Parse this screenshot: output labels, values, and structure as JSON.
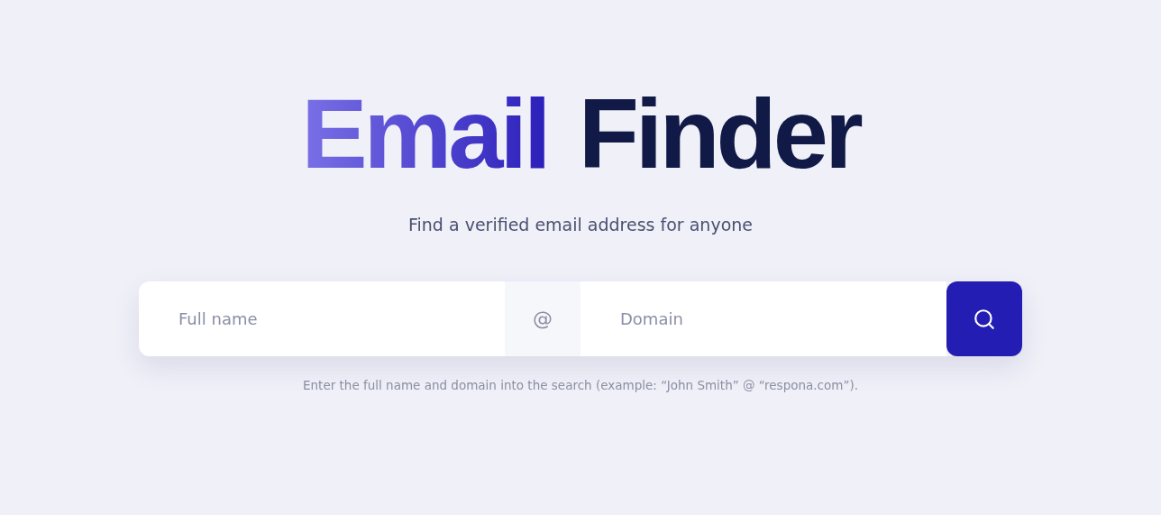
{
  "title": {
    "accent": "Email",
    "rest": "Finder"
  },
  "subtitle": "Find a verified email address for anyone",
  "search": {
    "name_placeholder": "Full name",
    "separator": "@",
    "domain_placeholder": "Domain"
  },
  "hint": "Enter the full name and domain into the search (example: “John Smith” @ “respona.com”)."
}
